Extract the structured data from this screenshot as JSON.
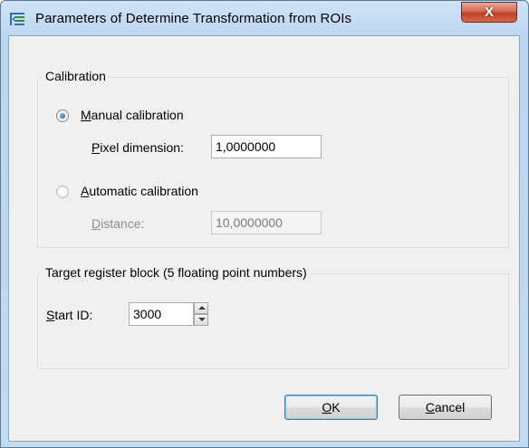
{
  "window": {
    "title": "Parameters of Determine Transformation from ROIs",
    "close_glyph": "X",
    "app_icon": "register-transform-icon"
  },
  "calibration": {
    "legend": "Calibration",
    "manual": {
      "accel": "M",
      "rest": "anual calibration",
      "selected": true
    },
    "pixel_dimension": {
      "accel": "P",
      "rest": "ixel dimension:",
      "value": "1,0000000"
    },
    "automatic": {
      "accel": "A",
      "rest": "utomatic calibration",
      "selected": false
    },
    "distance": {
      "accel": "D",
      "rest": "istance:",
      "value": "10,0000000"
    }
  },
  "target": {
    "legend": "Target register block (5 floating point numbers)",
    "start_id": {
      "accel": "S",
      "rest": "tart ID:",
      "value": "3000"
    }
  },
  "buttons": {
    "ok": {
      "accel": "O",
      "rest": "K"
    },
    "cancel": {
      "accel": "C",
      "rest": "ancel"
    }
  }
}
